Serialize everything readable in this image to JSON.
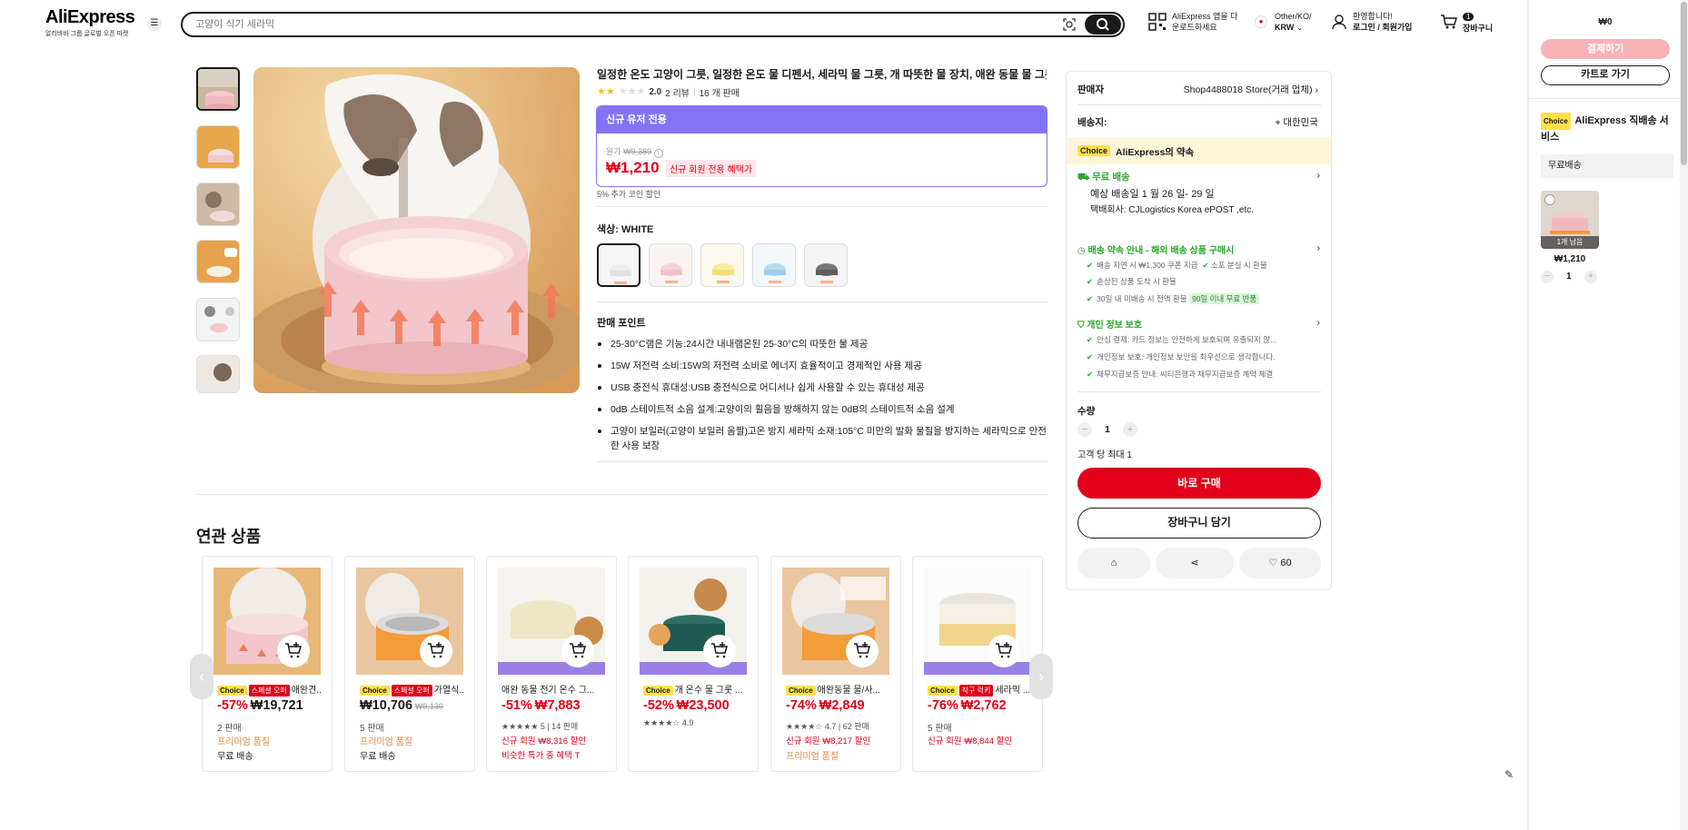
{
  "header": {
    "logo": "AliExpress",
    "logo_sub": "알리바바 그룹 글로벌 오픈 마켓",
    "search_placeholder": "고양이 식기 세라믹",
    "app_line1": "AliExpress 앱을 다",
    "app_line2": "운로드하세요",
    "region_line1": "Other/KO/",
    "region_line2": "KRW",
    "login_line1": "환영합니다!",
    "login_line2": "로그인 / 회원가입",
    "cart_count": "1",
    "cart_label": "장바구니"
  },
  "product": {
    "title": "일정한 온도 고양이 그릇, 일정한 온도 물 디펜서, 세라믹 물 그릇, 개 따뜻한 물 장치, 애완 동물 물 그릇 W",
    "rating": "2.0",
    "reviews": "2 리뷰",
    "sold": "16 개 판매",
    "promo_header": "신규 유저 전용",
    "orig_label": "원가",
    "orig_price": "₩9,389",
    "price": "₩1,210",
    "promo_tag": "신규 회원 전용 혜택가",
    "coin_note": "5% 추가 코인 할인",
    "color_label": "색상: WHITE",
    "selling_points_title": "판매 포인트",
    "selling_points": [
      "25-30°C램은 기능:24시간 내내램온된 25-30°C의 따뜻한 물 제공",
      "15W 저전력 소비:15W의 저전력 소비로 에너지 효율적이고 경제적인 사용 제공",
      "USB 충전식 휴대성:USB 충전식으로 어디서나 쉽게 사용할 수 있는 휴대성 제공",
      "0dB 스테이트적 소음 설계:고양이의 휠음을 방해하지 않는 0dB의 스테이트적 소음 설계",
      "고양이 보일러(고양이 보일러 옴짤)고온 방지 세라믹 소재:105°C 미만의 발화 물질을 방지하는 세라믹으로 안전한 사용 보장"
    ]
  },
  "related": {
    "title": "연관 상품",
    "items": [
      {
        "badges": [
          "Choice",
          "스페셜 오퍼"
        ],
        "name": "애완견...",
        "discount": "-57%",
        "price": "₩19,721",
        "sub1": "2 판매",
        "sub2": "프리미엄 품질",
        "sub3": "무료 배송"
      },
      {
        "badges": [
          "Choice",
          "스페셜 오퍼"
        ],
        "name": "가열식...",
        "discount": "",
        "price": "₩10,706",
        "old": "₩9,139",
        "sub1": "5 판매",
        "sub2": "프리미엄 품질",
        "sub3": "무료 배송"
      },
      {
        "badges": [],
        "name": "애완 동물 전기 온수 그...",
        "discount": "-51%",
        "price": "₩7,883",
        "sub1": "★★★★★ 5 | 14 판매",
        "sub2": "신규 회원 ₩8,316 할인",
        "sub3": "비슷한 특가 중 혜택 T"
      },
      {
        "badges": [
          "Choice"
        ],
        "name": "개 온수 물 그룻 ...",
        "discount": "-52%",
        "price": "₩23,500",
        "sub1": "★★★★☆ 4.9",
        "sub2": "",
        "sub3": ""
      },
      {
        "badges": [
          "Choice"
        ],
        "name": "애완동물 물/사...",
        "discount": "-74%",
        "price": "₩2,849",
        "sub1": "★★★★☆ 4.7 | 62 판매",
        "sub2": "신규 회원 ₩8,217 할인",
        "sub3": "프리미엄 품질"
      },
      {
        "badges": [
          "Choice",
          "직구 럭키"
        ],
        "name": "세라믹 ...",
        "discount": "-76%",
        "price": "₩2,762",
        "sub1": "5 판매",
        "sub2": "신규 회원 ₩8,844 할인",
        "sub3": ""
      }
    ]
  },
  "panel": {
    "seller_label": "판매자",
    "seller": "Shop4488018 Store(거래 업체)",
    "ship_to_label": "배송지:",
    "ship_to": "대한민국",
    "choice_badge": "Choice",
    "choice_promise": "AliExpress의 약속",
    "free_shipping": "무료 배송",
    "eta": "예상 배송일 1 월 26 일- 29 일",
    "carrier": "택배회사: CJLogistics  Korea ePOST ,etc.",
    "guarantee_title": "배송 약속 안내 - 해외 배송 상품 구매시",
    "g1": "배송 지연 시 ₩1,300 쿠폰 지급",
    "g1b": "소포 분실 시 환불",
    "g2": "손상된 상품 도착 시 환불",
    "g3": "30일 내 미배송 시 전액 환불",
    "g3b": "90일 이내 무료 반품",
    "privacy_title": "개인 정보 보호",
    "p1": "안심 결제: 카드 정보는 안전하게 보호되며 유출되지 않...",
    "p2": "개인정보 보호: 개인정보 보안을 최우선으로 생각합니다.",
    "p3": "채무지급보증 안내: 씨티은행과 채무지급보증 계약 체결",
    "qty_label": "수량",
    "qty": "1",
    "max_note": "고객 당 최대 1",
    "buy_now": "바로 구매",
    "add_cart": "장바구니 담기",
    "wish_count": "60"
  },
  "side": {
    "total": "₩0",
    "checkout": "결제하기",
    "go_cart": "카트로 가기",
    "choice_badge": "Choice",
    "choice_title": "AliExpress 직배송 서비스",
    "free_ship": "무료배송",
    "left_badge": "1개 남음",
    "item_price": "₩1,210",
    "item_qty": "1"
  }
}
